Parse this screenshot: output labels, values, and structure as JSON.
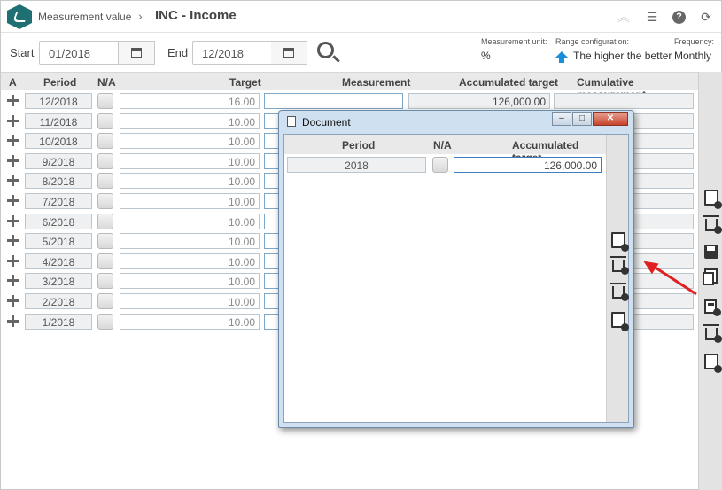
{
  "header": {
    "breadcrumb": "Measurement value",
    "title": "INC - Income"
  },
  "filters": {
    "start_label": "Start",
    "start_value": "01/2018",
    "end_label": "End",
    "end_value": "12/2018",
    "unit_label": "Measurement unit:",
    "unit_value": "%",
    "range_label": "Range configuration:",
    "range_value": "The higher the better",
    "freq_label": "Frequency:",
    "freq_value": "Monthly"
  },
  "table": {
    "columns": [
      "A",
      "Period",
      "N/A",
      "Target",
      "Measurement",
      "Accumulated target",
      "Cumulative measurement"
    ],
    "rows": [
      {
        "period": "12/2018",
        "target": "16.00",
        "accumulated": "126,000.00"
      },
      {
        "period": "11/2018",
        "target": "10.00",
        "accumulated": ""
      },
      {
        "period": "10/2018",
        "target": "10.00",
        "accumulated": ""
      },
      {
        "period": "9/2018",
        "target": "10.00",
        "accumulated": ""
      },
      {
        "period": "8/2018",
        "target": "10.00",
        "accumulated": ""
      },
      {
        "period": "7/2018",
        "target": "10.00",
        "accumulated": ""
      },
      {
        "period": "6/2018",
        "target": "10.00",
        "accumulated": ""
      },
      {
        "period": "5/2018",
        "target": "10.00",
        "accumulated": ""
      },
      {
        "period": "4/2018",
        "target": "10.00",
        "accumulated": ""
      },
      {
        "period": "3/2018",
        "target": "10.00",
        "accumulated": ""
      },
      {
        "period": "2/2018",
        "target": "10.00",
        "accumulated": ""
      },
      {
        "period": "1/2018",
        "target": "10.00",
        "accumulated": ""
      }
    ]
  },
  "toolbar_icons": [
    "new-document-icon",
    "delete-icon",
    "save-icon",
    "copy-icon",
    "calculate-icon",
    "delete-icon",
    "document-icon"
  ],
  "dialog": {
    "title": "Document",
    "columns": [
      "Period",
      "N/A",
      "Accumulated target"
    ],
    "row": {
      "period": "2018",
      "accumulated": "126,000.00"
    }
  },
  "colors": {
    "accent": "#1a8fd8",
    "brand": "#1f6f73",
    "annotation": "#e02020"
  }
}
